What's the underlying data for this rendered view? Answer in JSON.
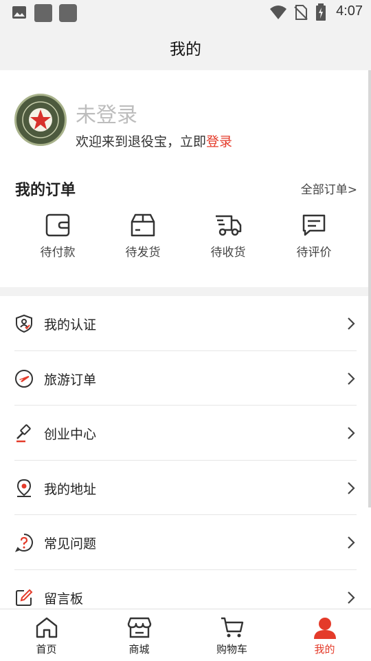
{
  "status_bar": {
    "time": "4:07"
  },
  "header": {
    "title": "我的"
  },
  "profile": {
    "login_title": "未登录",
    "welcome_text": "欢迎来到退役宝，立即",
    "login_link": "登录"
  },
  "orders": {
    "title": "我的订单",
    "all_link": "全部订单>",
    "items": [
      {
        "label": "待付款",
        "icon": "wallet-icon"
      },
      {
        "label": "待发货",
        "icon": "package-icon"
      },
      {
        "label": "待收货",
        "icon": "delivery-truck-icon"
      },
      {
        "label": "待评价",
        "icon": "comment-icon"
      }
    ]
  },
  "menu": {
    "items": [
      {
        "label": "我的认证",
        "icon": "shield-user-icon"
      },
      {
        "label": "旅游订单",
        "icon": "airplane-icon"
      },
      {
        "label": "创业中心",
        "icon": "gavel-icon"
      },
      {
        "label": "我的地址",
        "icon": "location-pin-icon"
      },
      {
        "label": "常见问题",
        "icon": "question-icon"
      },
      {
        "label": "留言板",
        "icon": "edit-icon"
      }
    ]
  },
  "bottom_nav": {
    "items": [
      {
        "label": "首页",
        "icon": "home-icon"
      },
      {
        "label": "商城",
        "icon": "store-icon"
      },
      {
        "label": "购物车",
        "icon": "cart-icon"
      },
      {
        "label": "我的",
        "icon": "user-icon",
        "active": true
      }
    ]
  },
  "colors": {
    "accent": "#e43b2a",
    "icon_red": "#e43b2a",
    "text_gray": "#bdbdbd"
  }
}
